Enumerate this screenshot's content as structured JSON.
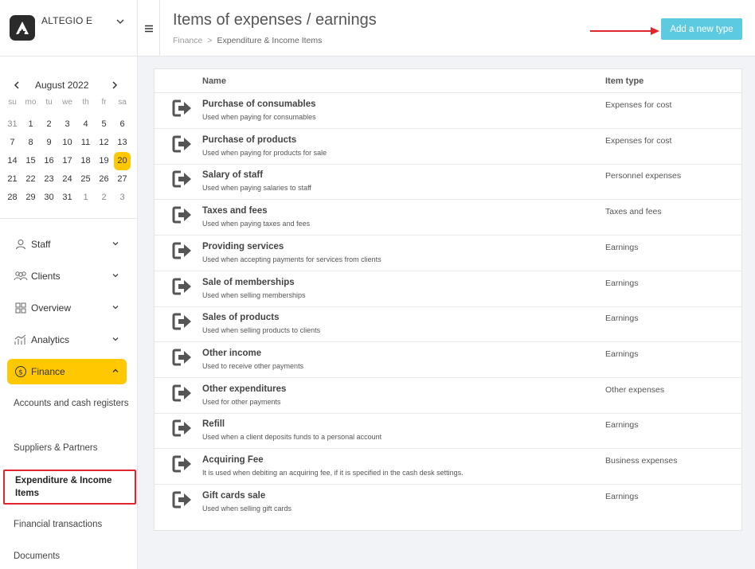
{
  "brand": {
    "name": "ALTEGIO E"
  },
  "calendar": {
    "month": "August 2022",
    "weekdays": [
      "su",
      "mo",
      "tu",
      "we",
      "th",
      "fr",
      "sa"
    ],
    "days": [
      "31",
      "1",
      "2",
      "3",
      "4",
      "5",
      "6",
      "7",
      "8",
      "9",
      "10",
      "11",
      "12",
      "13",
      "14",
      "15",
      "16",
      "17",
      "18",
      "19",
      "20",
      "21",
      "22",
      "23",
      "24",
      "25",
      "26",
      "27",
      "28",
      "29",
      "30",
      "31",
      "1",
      "2",
      "3"
    ],
    "muted": [
      0,
      32,
      33,
      34
    ],
    "today_index": 20
  },
  "nav": {
    "staff": "Staff",
    "clients": "Clients",
    "overview": "Overview",
    "analytics": "Analytics",
    "finance": "Finance"
  },
  "finance_sub": {
    "accounts": "Accounts and cash registers",
    "suppliers": "Suppliers & Partners",
    "expenditure": "Expenditure & Income Items",
    "transactions": "Financial transactions",
    "documents": "Documents"
  },
  "header": {
    "title": "Items of expenses / earnings",
    "crumb_root": "Finance",
    "crumb_sep": ">",
    "crumb_current": "Expenditure & Income Items",
    "add_button": "Add a new type"
  },
  "table": {
    "col_name": "Name",
    "col_type": "Item type",
    "rows": [
      {
        "name": "Purchase of consumables",
        "desc": "Used when paying for consumables",
        "type": "Expenses for cost"
      },
      {
        "name": "Purchase of products",
        "desc": "Used when paying for products for sale",
        "type": "Expenses for cost"
      },
      {
        "name": "Salary of staff",
        "desc": "Used when paying salaries to staff",
        "type": "Personnel expenses"
      },
      {
        "name": "Taxes and fees",
        "desc": "Used when paying taxes and fees",
        "type": "Taxes and fees"
      },
      {
        "name": "Providing services",
        "desc": "Used when accepting payments for services from clients",
        "type": "Earnings"
      },
      {
        "name": "Sale of memberships",
        "desc": "Used when selling memberships",
        "type": "Earnings"
      },
      {
        "name": "Sales of products",
        "desc": "Used when selling products to clients",
        "type": "Earnings"
      },
      {
        "name": "Other income",
        "desc": "Used to receive other payments",
        "type": "Earnings"
      },
      {
        "name": "Other expenditures",
        "desc": "Used for other payments",
        "type": "Other expenses"
      },
      {
        "name": "Refill",
        "desc": "Used when a client deposits funds to a personal account",
        "type": "Earnings"
      },
      {
        "name": "Acquiring Fee",
        "desc": "It is used when debiting an acquiring fee, if it is specified in the cash desk settings.",
        "type": "Business expenses"
      },
      {
        "name": "Gift cards sale",
        "desc": "Used when selling gift cards",
        "type": "Earnings"
      }
    ]
  },
  "colors": {
    "accent": "#ffc800",
    "button": "#5ccae0",
    "highlight": "#e0262c"
  }
}
